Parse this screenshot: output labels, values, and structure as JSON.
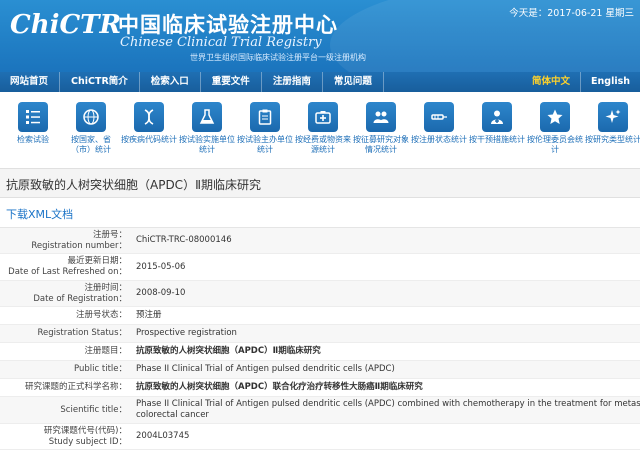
{
  "header": {
    "logo_text": "ChiCTR",
    "site_name_cn": "中国临床试验注册中心",
    "site_name_en": "Chinese Clinical Trial Registry",
    "subtitle": "世界卫生组织国际临床试验注册平台一级注册机构",
    "date": "今天是：2017-06-21 星期三"
  },
  "nav": {
    "items": [
      "网站首页",
      "ChiCTR简介",
      "检索入口",
      "重要文件",
      "注册指南",
      "常见问题"
    ],
    "lang_cn": "简体中文",
    "lang_en": "English"
  },
  "icons": [
    {
      "label": "检索试验",
      "icon": "list-icon"
    },
    {
      "label": "按国家、省（市）统计",
      "icon": "globe-icon"
    },
    {
      "label": "按疾病代码统计",
      "icon": "dna-icon"
    },
    {
      "label": "按试验实施单位统计",
      "icon": "flask-icon"
    },
    {
      "label": "按试验主办单位统计",
      "icon": "clipboard-icon"
    },
    {
      "label": "按经费或物资来源统计",
      "icon": "medkit-icon"
    },
    {
      "label": "按征募研究对象情况统计",
      "icon": "people-icon"
    },
    {
      "label": "按注册状态统计",
      "icon": "syringe-icon"
    },
    {
      "label": "按干预措施统计",
      "icon": "doctor-icon"
    },
    {
      "label": "按伦理委员会统计",
      "icon": "star-icon"
    },
    {
      "label": "按研究类型统计",
      "icon": "sparkle-icon"
    }
  ],
  "page": {
    "title": "抗原致敏的人树突状细胞（APDC）Ⅱ期临床研究",
    "xml_link": "下载XML文档"
  },
  "details": [
    {
      "label_cn": "注册号：",
      "label_en": "Registration number：",
      "value": [
        "ChiCTR-TRC-08000146"
      ]
    },
    {
      "label_cn": "最近更新日期：",
      "label_en": "Date of Last Refreshed on：",
      "value": [
        "2015-05-06"
      ]
    },
    {
      "label_cn": "注册时间：",
      "label_en": "Date of Registration：",
      "value": [
        "2008-09-10"
      ]
    },
    {
      "label_cn": "注册号状态：",
      "label_en": "",
      "value": [
        "预注册"
      ]
    },
    {
      "label_cn": "",
      "label_en": "Registration Status：",
      "value": [
        "Prospective registration"
      ]
    },
    {
      "label_cn": "注册题目：",
      "label_en": "",
      "value": [
        "抗原致敏的人树突状细胞（APDC）Ⅱ期临床研究"
      ]
    },
    {
      "label_cn": "",
      "label_en": "Public title：",
      "value": [
        "Phase II Clinical Trial of Antigen pulsed dendritic cells (APDC)"
      ]
    },
    {
      "label_cn": "研究课题的正式科学名称：",
      "label_en": "",
      "value": [
        "抗原致敏的人树突状细胞（APDC）联合化疗治疗转移性大肠癌Ⅱ期临床研究"
      ]
    },
    {
      "label_cn": "",
      "label_en": "Scientific title：",
      "value": [
        "Phase II Clinical Trial of Antigen pulsed dendritic cells (APDC) combined with chemotherapy in the treatment for metastatic",
        "colorectal cancer"
      ]
    },
    {
      "label_cn": "研究课题代号(代码)：",
      "label_en": "Study subject ID：",
      "value": [
        "2004L03745"
      ]
    }
  ]
}
